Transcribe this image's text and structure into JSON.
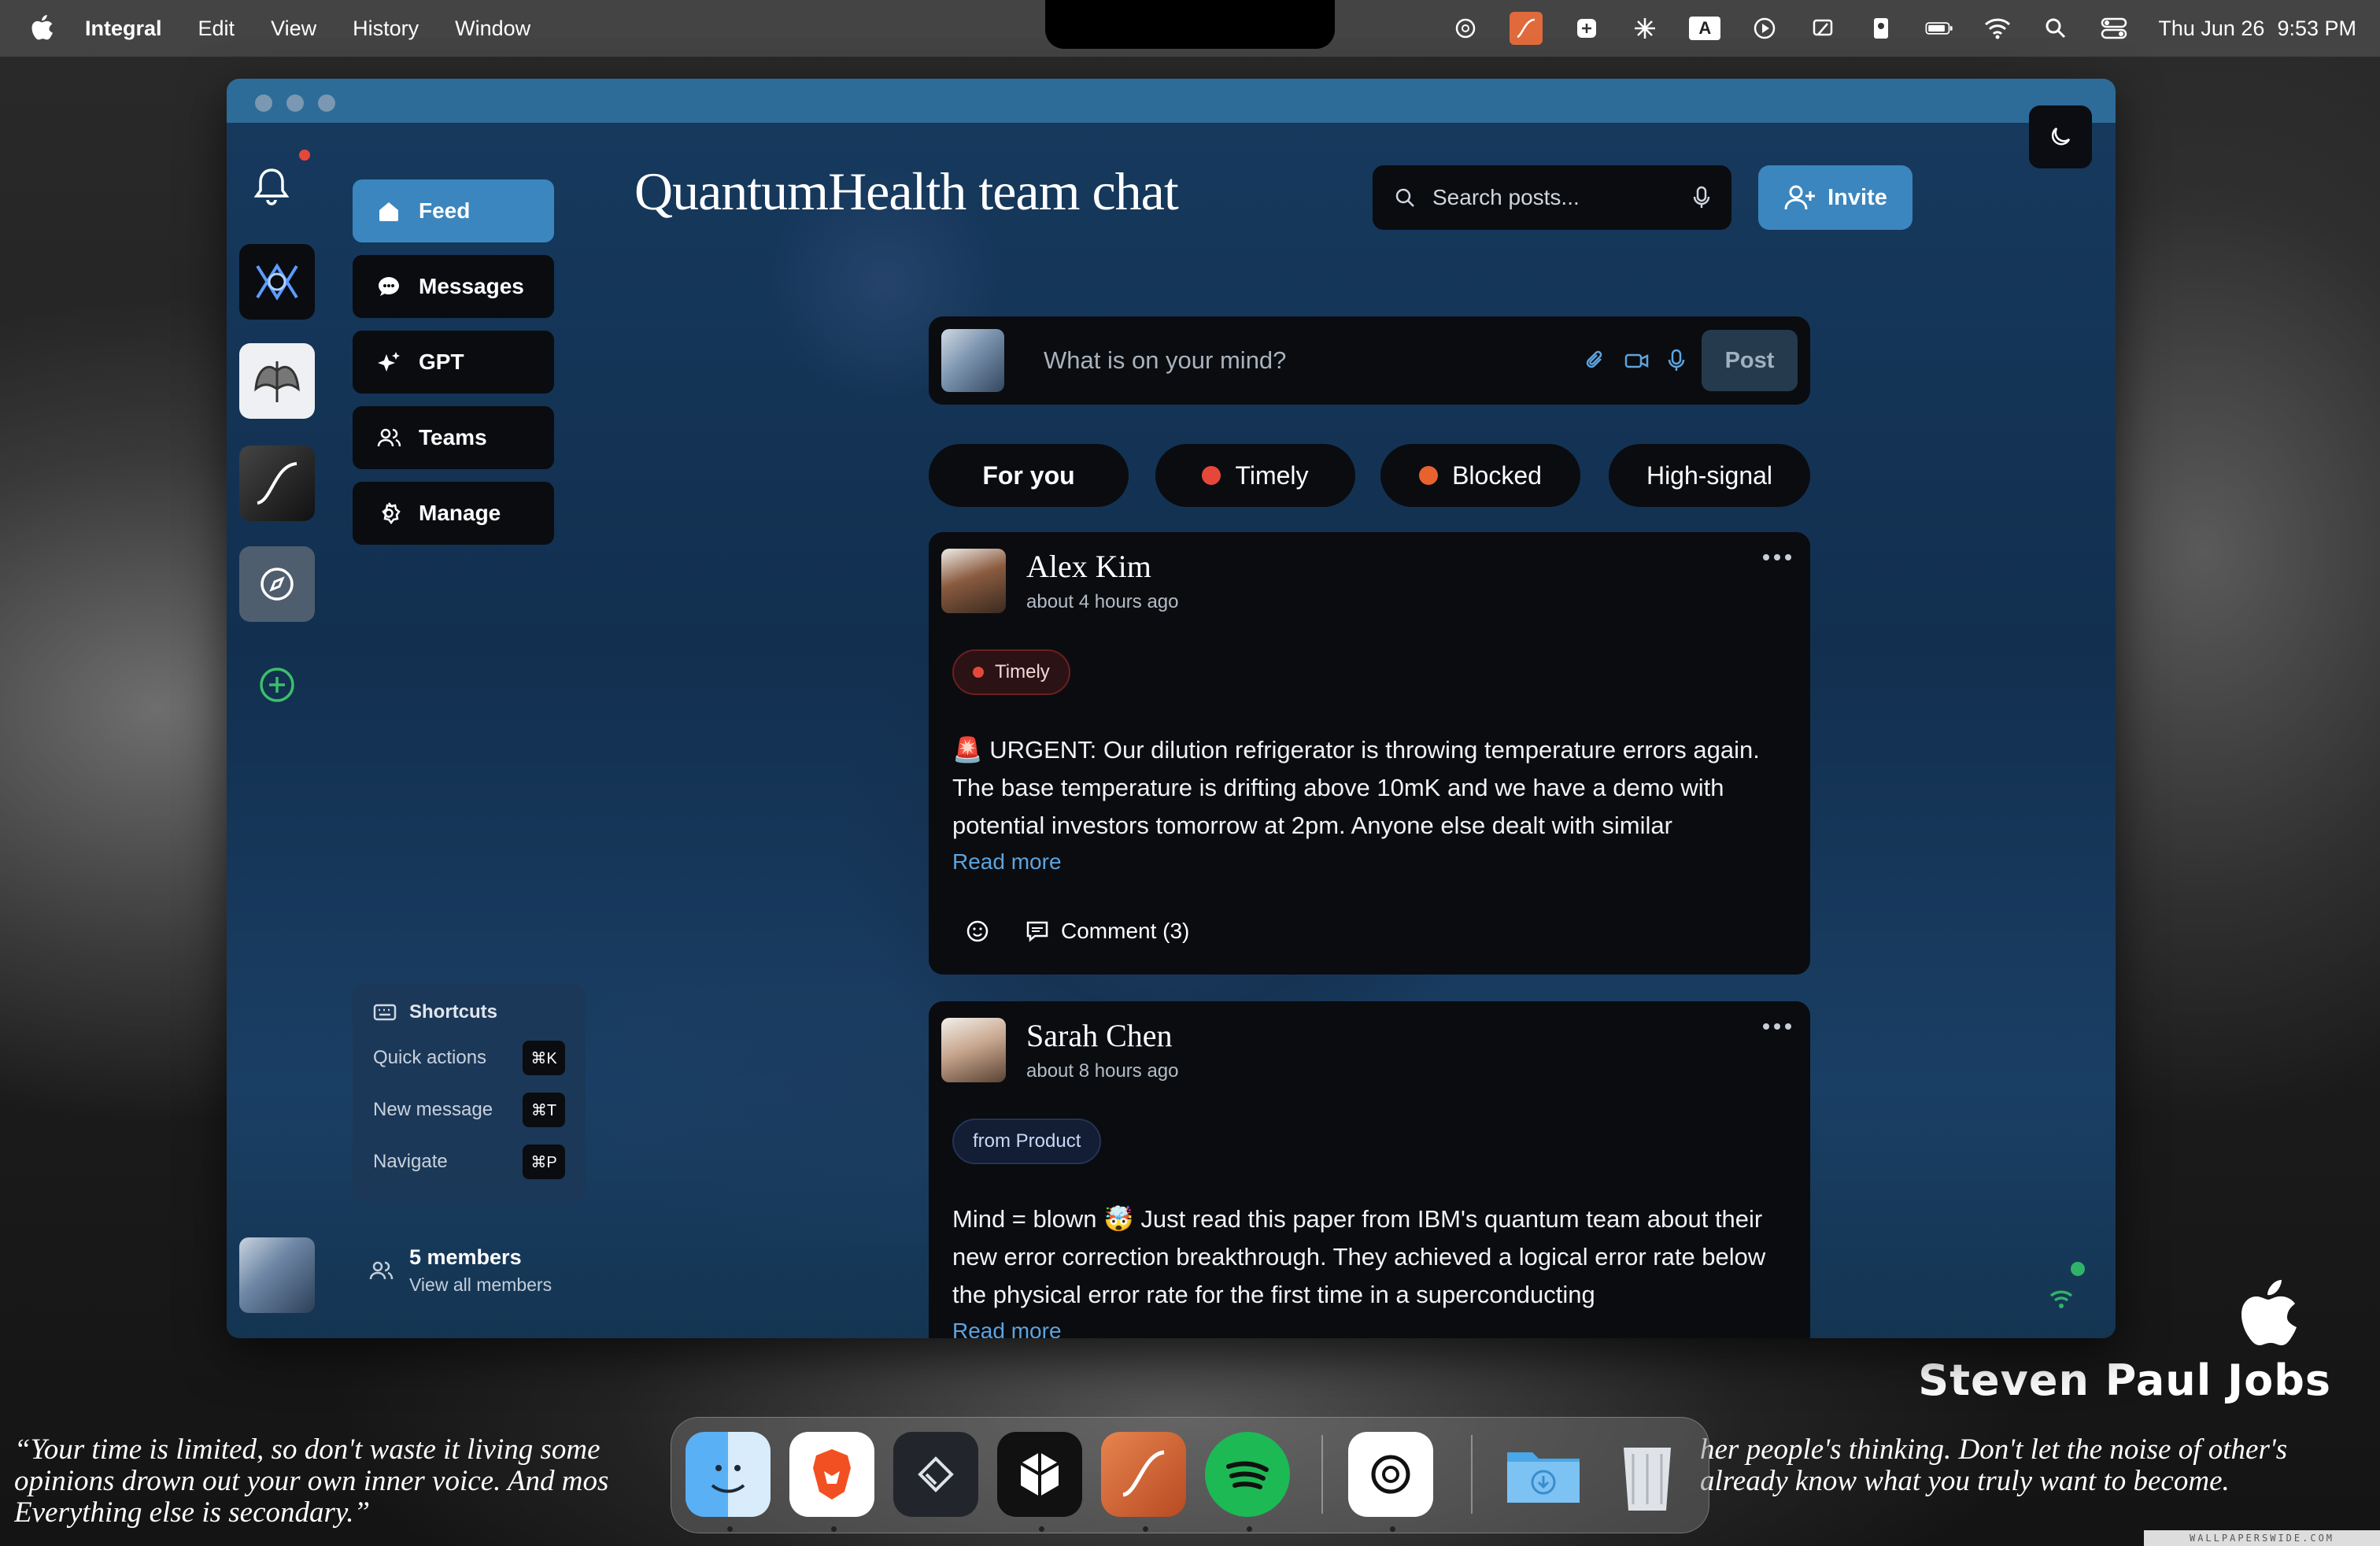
{
  "menubar": {
    "app_name": "Integral",
    "items": [
      "Edit",
      "View",
      "History",
      "Window"
    ],
    "status_icons": [
      "chatgpt-icon",
      "app-orange-icon",
      "perplexity-icon",
      "claude-icon",
      "input-source-icon",
      "play-icon",
      "screen-icon",
      "contact-icon",
      "battery-icon",
      "wifi-icon",
      "spotlight-icon",
      "control-center-icon"
    ],
    "input_source": "A",
    "date": "Thu Jun 26",
    "time": "9:53 PM"
  },
  "app": {
    "title": "QuantumHealth team chat",
    "search": {
      "placeholder": "Search posts..."
    },
    "invite_label": "Invite",
    "nav": [
      {
        "label": "Feed",
        "icon": "home-icon",
        "active": true
      },
      {
        "label": "Messages",
        "icon": "chat-bubble-icon",
        "active": false
      },
      {
        "label": "GPT",
        "icon": "sparkles-icon",
        "active": false
      },
      {
        "label": "Teams",
        "icon": "users-icon",
        "active": false
      },
      {
        "label": "Manage",
        "icon": "gear-icon",
        "active": false
      }
    ],
    "shortcuts": {
      "title": "Shortcuts",
      "items": [
        {
          "label": "Quick actions",
          "key": "⌘K"
        },
        {
          "label": "New message",
          "key": "⌘T"
        },
        {
          "label": "Navigate",
          "key": "⌘P"
        }
      ]
    },
    "members": {
      "count_label": "5 members",
      "link_label": "View all members"
    },
    "composer": {
      "placeholder": "What is on your mind?",
      "post_label": "Post"
    },
    "filters": [
      {
        "label": "For you",
        "dot": null,
        "active": true
      },
      {
        "label": "Timely",
        "dot": "#e5483b",
        "active": false
      },
      {
        "label": "Blocked",
        "dot": "#e8622f",
        "active": false
      },
      {
        "label": "High-signal",
        "dot": null,
        "active": false
      }
    ],
    "posts": [
      {
        "author": "Alex Kim",
        "time": "about 4 hours ago",
        "tag": "Timely",
        "body": "🚨 URGENT: Our dilution refrigerator is throwing temperature errors again. The base temperature is drifting above 10mK and we have a demo with potential investors tomorrow at 2pm. Anyone else dealt with similar",
        "read_more": "Read more",
        "comment_label": "Comment (3)"
      },
      {
        "author": "Sarah Chen",
        "time": "about 8 hours ago",
        "tag": "from Product",
        "body": "Mind = blown 🤯 Just read this paper from IBM's quantum team about their new error correction breakthrough. They achieved a logical error rate below the physical error rate for the first time in a superconducting",
        "read_more": "Read more"
      }
    ]
  },
  "wallpaper": {
    "name": "Steven Paul Jobs",
    "quote_left": "“Your time is limited, so don't waste it living some opinions drown out your own inner voice. And mos Everything else is secondary.”",
    "quote_left_lines": [
      "“Your time is limited, so don't waste it living some",
      "opinions drown out your own inner voice. And mos",
      "Everything else is secondary.”"
    ],
    "quote_right_lines": [
      "her people's thinking. Don't let the noise of other's",
      "already know what you truly want to become."
    ],
    "credit": "WALLPAPERSWIDE.COM"
  },
  "dock": {
    "apps": [
      "finder-icon",
      "brave-icon",
      "linear-icon",
      "perplexity-icon",
      "integral-icon",
      "spotify-icon",
      "chatgpt-icon",
      "downloads-folder-icon",
      "trash-icon"
    ]
  },
  "colors": {
    "accent": "#3b86be",
    "timely": "#e5483b",
    "blocked": "#e8622f",
    "link": "#5ea4de",
    "online": "#2fb36a"
  }
}
